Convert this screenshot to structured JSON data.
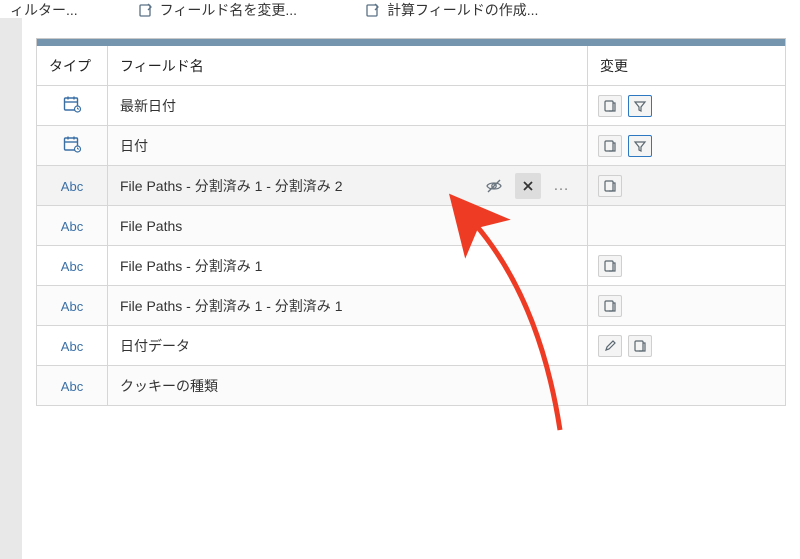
{
  "toolbar": {
    "filter_label": "ィルター...",
    "rename_label": "フィールド名を変更...",
    "calc_label": "計算フィールドの作成..."
  },
  "headers": {
    "type": "タイプ",
    "name": "フィールド名",
    "change": "変更"
  },
  "type_labels": {
    "abc": "Abc"
  },
  "rows": [
    {
      "type": "date",
      "name": "最新日付",
      "changes": [
        "group",
        "filter_active"
      ],
      "selected": false
    },
    {
      "type": "date",
      "name": "日付",
      "changes": [
        "group",
        "filter_active"
      ],
      "selected": false
    },
    {
      "type": "abc",
      "name": "File Paths - 分割済み 1 - 分割済み 2",
      "changes": [
        "group"
      ],
      "selected": true,
      "hidden": true,
      "show_delete": true,
      "show_more": true
    },
    {
      "type": "abc",
      "name": "File Paths",
      "changes": [],
      "selected": false
    },
    {
      "type": "abc",
      "name": "File Paths - 分割済み 1",
      "changes": [
        "group"
      ],
      "selected": false
    },
    {
      "type": "abc",
      "name": "File Paths - 分割済み 1 - 分割済み 1",
      "changes": [
        "group"
      ],
      "selected": false
    },
    {
      "type": "abc",
      "name": "日付データ",
      "changes": [
        "edit",
        "group"
      ],
      "selected": false
    },
    {
      "type": "abc",
      "name": "クッキーの種類",
      "changes": [],
      "selected": false
    }
  ],
  "colors": {
    "accent": "#7594ae",
    "arrow": "#ee3b24"
  }
}
